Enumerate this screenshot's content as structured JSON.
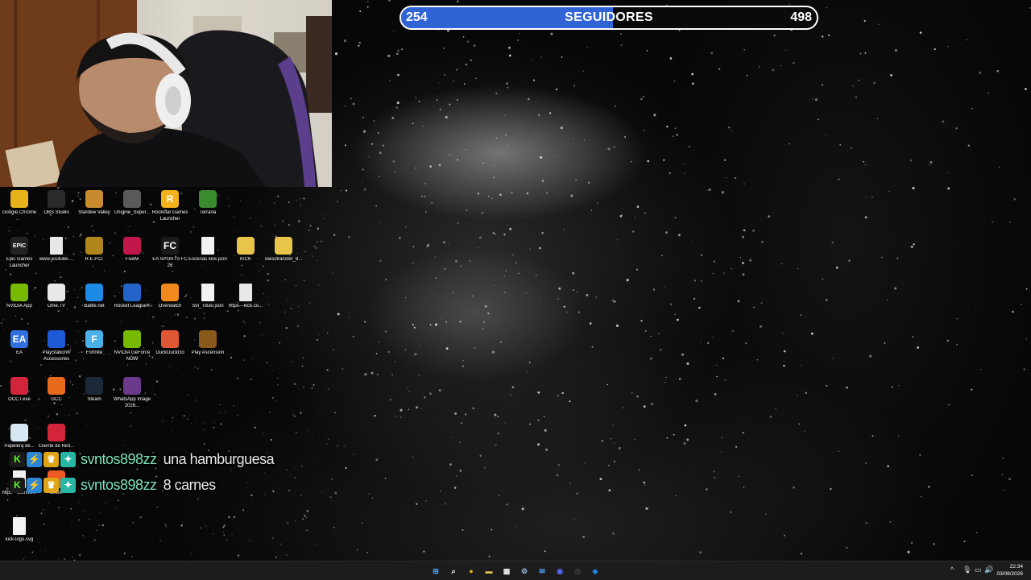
{
  "follower_bar": {
    "current": "254",
    "label": "SEGUIDORES",
    "goal": "498",
    "progress_fraction": 0.51,
    "fill_color": "#2f63d6"
  },
  "desktop_icons": [
    {
      "label": "Google Chrome",
      "icon": "chrome-icon",
      "color": "#e8b21a",
      "glyph": ""
    },
    {
      "label": "OBS Studio",
      "icon": "obs-icon",
      "color": "#2a2a2a",
      "glyph": ""
    },
    {
      "label": "Stardew Valley",
      "icon": "stardew-icon",
      "color": "#c98a2e",
      "glyph": ""
    },
    {
      "label": "Unigine_Super...",
      "icon": "unigine-icon",
      "color": "#5a5a5a",
      "glyph": ""
    },
    {
      "label": "Rockstar Games Launcher",
      "icon": "rockstar-icon",
      "color": "#f2b21c",
      "glyph": "R"
    },
    {
      "label": "Terraria",
      "icon": "terraria-icon",
      "color": "#3a8a2e",
      "glyph": ""
    },
    {
      "label": "Epic Games Launcher",
      "icon": "epic-games-icon",
      "color": "#222222",
      "glyph": "EPIC"
    },
    {
      "label": "www.youtube....",
      "icon": "chrome-shortcut-icon",
      "color": "#e8e8e8",
      "glyph": ""
    },
    {
      "label": "R.E.P.O.",
      "icon": "repo-icon",
      "color": "#b0861c",
      "glyph": ""
    },
    {
      "label": "FiveM",
      "icon": "fivem-icon",
      "color": "#c2174a",
      "glyph": ""
    },
    {
      "label": "EA SPORTS FC 26",
      "icon": "ea-fc-icon",
      "color": "#1a1a1a",
      "glyph": "FC"
    },
    {
      "label": "Escenas kick.json",
      "icon": "file-icon",
      "color": "#f2f2f2",
      "glyph": ""
    },
    {
      "label": "KICK",
      "icon": "folder-icon",
      "color": "#e8c44a",
      "glyph": ""
    },
    {
      "label": "swisstransfer_8...",
      "icon": "zip-folder-icon",
      "color": "#e8c44a",
      "glyph": ""
    },
    {
      "label": "NVIDIA App",
      "icon": "nvidia-icon",
      "color": "#76b900",
      "glyph": ""
    },
    {
      "label": "Ome.TV",
      "icon": "ometv-icon",
      "color": "#e8e8e8",
      "glyph": ""
    },
    {
      "label": "Battle.net",
      "icon": "battlenet-icon",
      "color": "#1d8ae5",
      "glyph": ""
    },
    {
      "label": "Rocket League®",
      "icon": "rocket-league-icon",
      "color": "#2463c9",
      "glyph": ""
    },
    {
      "label": "Overwatch",
      "icon": "overwatch-icon",
      "color": "#f08a1e",
      "glyph": ""
    },
    {
      "label": "Sin_Titulo.json",
      "icon": "file-icon",
      "color": "#f2f2f2",
      "glyph": ""
    },
    {
      "label": "https---kick.co...",
      "icon": "chrome-shortcut-icon",
      "color": "#e8e8e8",
      "glyph": ""
    },
    {
      "label": "EA",
      "icon": "ea-icon",
      "color": "#2f6fe0",
      "glyph": "EA"
    },
    {
      "label": "PlayStation® Accessories",
      "icon": "playstation-icon",
      "color": "#1f5ad6",
      "glyph": ""
    },
    {
      "label": "Fortnite",
      "icon": "fortnite-icon",
      "color": "#4ab0e8",
      "glyph": "F"
    },
    {
      "label": "NVIDIA GeForce NOW",
      "icon": "geforce-now-icon",
      "color": "#76b900",
      "glyph": ""
    },
    {
      "label": "DuckDuckGo",
      "icon": "duckduckgo-icon",
      "color": "#de5833",
      "glyph": ""
    },
    {
      "label": "Play Ascension",
      "icon": "ascension-icon",
      "color": "#8a5a1c",
      "glyph": ""
    },
    {
      "label": "OCCT.exe",
      "icon": "occt-icon",
      "color": "#d3253a",
      "glyph": ""
    },
    {
      "label": "GCC",
      "icon": "gcc-icon",
      "color": "#e86a1c",
      "glyph": ""
    },
    {
      "label": "Steam",
      "icon": "steam-icon",
      "color": "#1b2838",
      "glyph": ""
    },
    {
      "label": "WhatsApp Image 2026...",
      "icon": "image-file-icon",
      "color": "#6b3a8a",
      "glyph": ""
    },
    {
      "label": "Papelera de...",
      "icon": "recycle-bin-icon",
      "color": "#d8e8f2",
      "glyph": ""
    },
    {
      "label": "Cliente de Riot...",
      "icon": "riot-client-icon",
      "color": "#d3253a",
      "glyph": ""
    },
    {
      "label": "https---botrix.li...",
      "icon": "file-icon",
      "color": "#f2f2f2",
      "glyph": ""
    },
    {
      "label": "Brave",
      "icon": "brave-icon",
      "color": "#f05a24",
      "glyph": ""
    },
    {
      "label": "kick-logo.svg",
      "icon": "file-icon",
      "color": "#f2f2f2",
      "glyph": ""
    }
  ],
  "chat": [
    {
      "user": "svntos898zz",
      "message": "una hamburguesa"
    },
    {
      "user": "svntos898zz",
      "message": "8 carnes"
    }
  ],
  "chat_badges": [
    {
      "icon": "kick-badge-icon",
      "glyph": "K",
      "bg": "#1a1a1a",
      "fg": "#53fc18"
    },
    {
      "icon": "lightning-badge-icon",
      "glyph": "⚡",
      "bg": "#2b86d6",
      "fg": "#ffffff"
    },
    {
      "icon": "crown-badge-icon",
      "glyph": "♛",
      "bg": "#e0a418",
      "fg": "#ffffff"
    },
    {
      "icon": "gift-badge-icon",
      "glyph": "✦",
      "bg": "#27b7a4",
      "fg": "#ffffff"
    }
  ],
  "taskbar": {
    "apps": [
      {
        "icon": "start-icon",
        "color": "#4aa3ff",
        "glyph": "⊞"
      },
      {
        "icon": "search-icon",
        "color": "#ffffff",
        "glyph": "⌕"
      },
      {
        "icon": "chrome-icon",
        "color": "#e8b21a",
        "glyph": "●"
      },
      {
        "icon": "file-explorer-icon",
        "color": "#e8c44a",
        "glyph": "▬"
      },
      {
        "icon": "store-icon",
        "color": "#f2f2f2",
        "glyph": "▦"
      },
      {
        "icon": "settings-icon",
        "color": "#9ab4d6",
        "glyph": "⚙"
      },
      {
        "icon": "mail-icon",
        "color": "#4aa3ff",
        "glyph": "✉"
      },
      {
        "icon": "discord-icon",
        "color": "#5865f2",
        "glyph": "◉"
      },
      {
        "icon": "obs-taskbar-icon",
        "color": "#444444",
        "glyph": "◎"
      },
      {
        "icon": "battlenet-taskbar-icon",
        "color": "#1d8ae5",
        "glyph": "◈"
      }
    ],
    "tray": {
      "chevron": "^",
      "mic": "🎙",
      "network": "▭",
      "volume": "🔊"
    },
    "time": "22:34",
    "date": "03/08/2026"
  }
}
